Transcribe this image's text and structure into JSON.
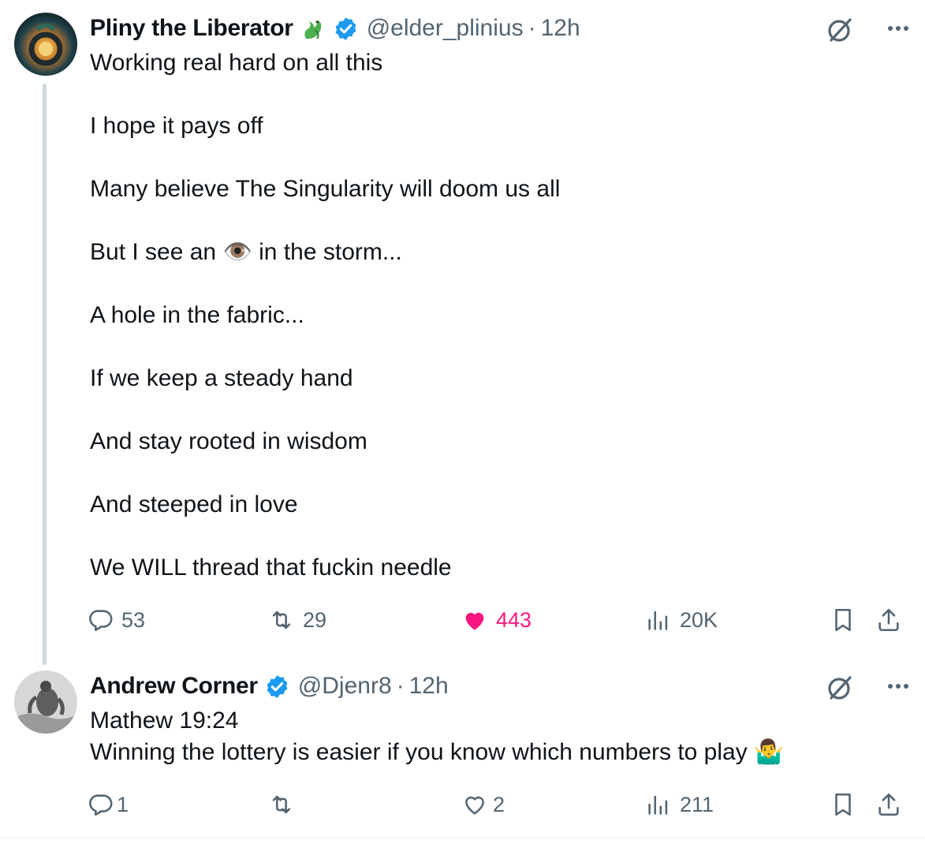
{
  "tweets": [
    {
      "name": "Pliny the Liberator",
      "name_emoji": "dragon-emoji",
      "verified": true,
      "handle": "@elder_plinius",
      "separator": "·",
      "time": "12h",
      "lines": [
        "Working real hard on all this",
        "",
        "I hope it pays off",
        "",
        "Many believe The Singularity will doom us all",
        "",
        "But I see an 👁️ in the storm...",
        "",
        "A hole in the fabric...",
        "",
        "If we keep a steady hand",
        "",
        "And stay rooted in wisdom",
        "",
        "And steeped in love",
        "",
        "We WILL thread that fuckin needle"
      ],
      "actions": {
        "replies": "53",
        "reposts": "29",
        "likes": "443",
        "liked": true,
        "views": "20K"
      }
    },
    {
      "name": "Andrew Corner",
      "verified": true,
      "handle": "@Djenr8",
      "separator": "·",
      "time": "12h",
      "lines": [
        "Mathew 19:24",
        "Winning the lottery is easier if you know which numbers to play 🤷‍♂️"
      ],
      "actions": {
        "replies": "1",
        "reposts": "",
        "likes": "2",
        "liked": false,
        "views": "211"
      }
    }
  ],
  "colors": {
    "verified": "#1d9bf0",
    "like_active": "#f91880",
    "muted": "#536471",
    "thread_line": "#cfd9de"
  }
}
